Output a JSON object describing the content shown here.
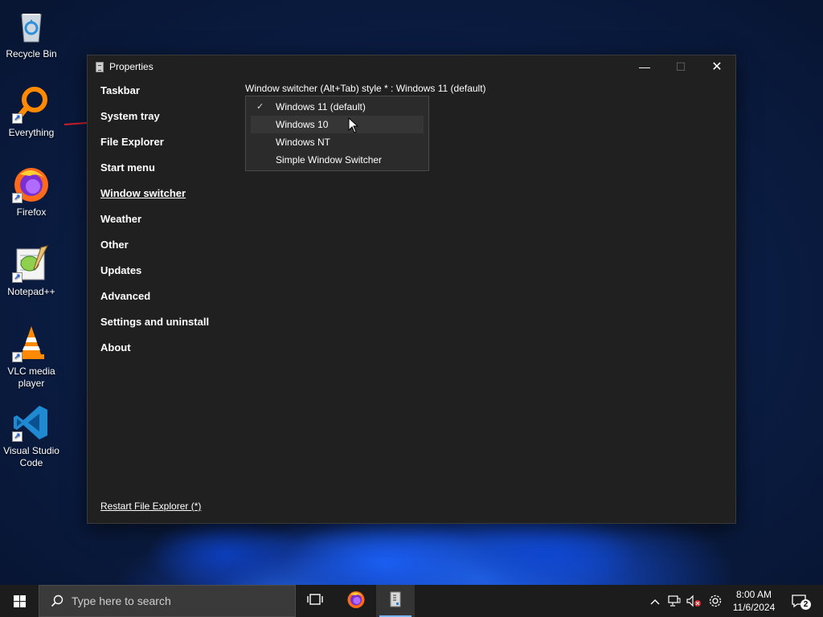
{
  "desktop": {
    "icons": [
      {
        "label": "Recycle Bin",
        "icon": "recycle-bin-icon"
      },
      {
        "label": "Everything",
        "icon": "everything-search-icon"
      },
      {
        "label": "Firefox",
        "icon": "firefox-icon"
      },
      {
        "label": "Notepad++",
        "icon": "notepad-plus-plus-icon"
      },
      {
        "label": "VLC media player",
        "icon": "vlc-icon"
      },
      {
        "label": "Visual Studio Code",
        "icon": "vscode-icon"
      }
    ]
  },
  "window": {
    "title": "Properties",
    "controls": {
      "minimize": "—",
      "maximize": "☐",
      "close": "✕"
    },
    "nav": [
      {
        "label": "Taskbar"
      },
      {
        "label": "System tray"
      },
      {
        "label": "File Explorer"
      },
      {
        "label": "Start menu"
      },
      {
        "label": "Window switcher",
        "active": true
      },
      {
        "label": "Weather"
      },
      {
        "label": "Other"
      },
      {
        "label": "Updates"
      },
      {
        "label": "Advanced"
      },
      {
        "label": "Settings and uninstall"
      },
      {
        "label": "About"
      }
    ],
    "restart_link": "Restart File Explorer (*)",
    "setting": {
      "label": "Window switcher (Alt+Tab) style * : Windows 11 (default)",
      "options": [
        {
          "label": "Windows 11 (default)",
          "checked": true
        },
        {
          "label": "Windows 10",
          "hovered": true
        },
        {
          "label": "Windows NT"
        },
        {
          "label": "Simple Window Switcher"
        }
      ],
      "check_glyph": "✓"
    }
  },
  "taskbar": {
    "search_placeholder": "Type here to search",
    "apps": [
      {
        "name": "task-view",
        "icon": "task-view-icon"
      },
      {
        "name": "firefox",
        "icon": "firefox-icon"
      },
      {
        "name": "properties",
        "icon": "properties-app-icon",
        "active": true
      }
    ],
    "tray": {
      "chevron": "^",
      "time": "8:00 AM",
      "date": "11/6/2024",
      "notification_count": "2"
    }
  },
  "colors": {
    "window_bg": "#202020",
    "taskbar_bg": "#1c1c1c",
    "accent": "#7ab7ff"
  }
}
